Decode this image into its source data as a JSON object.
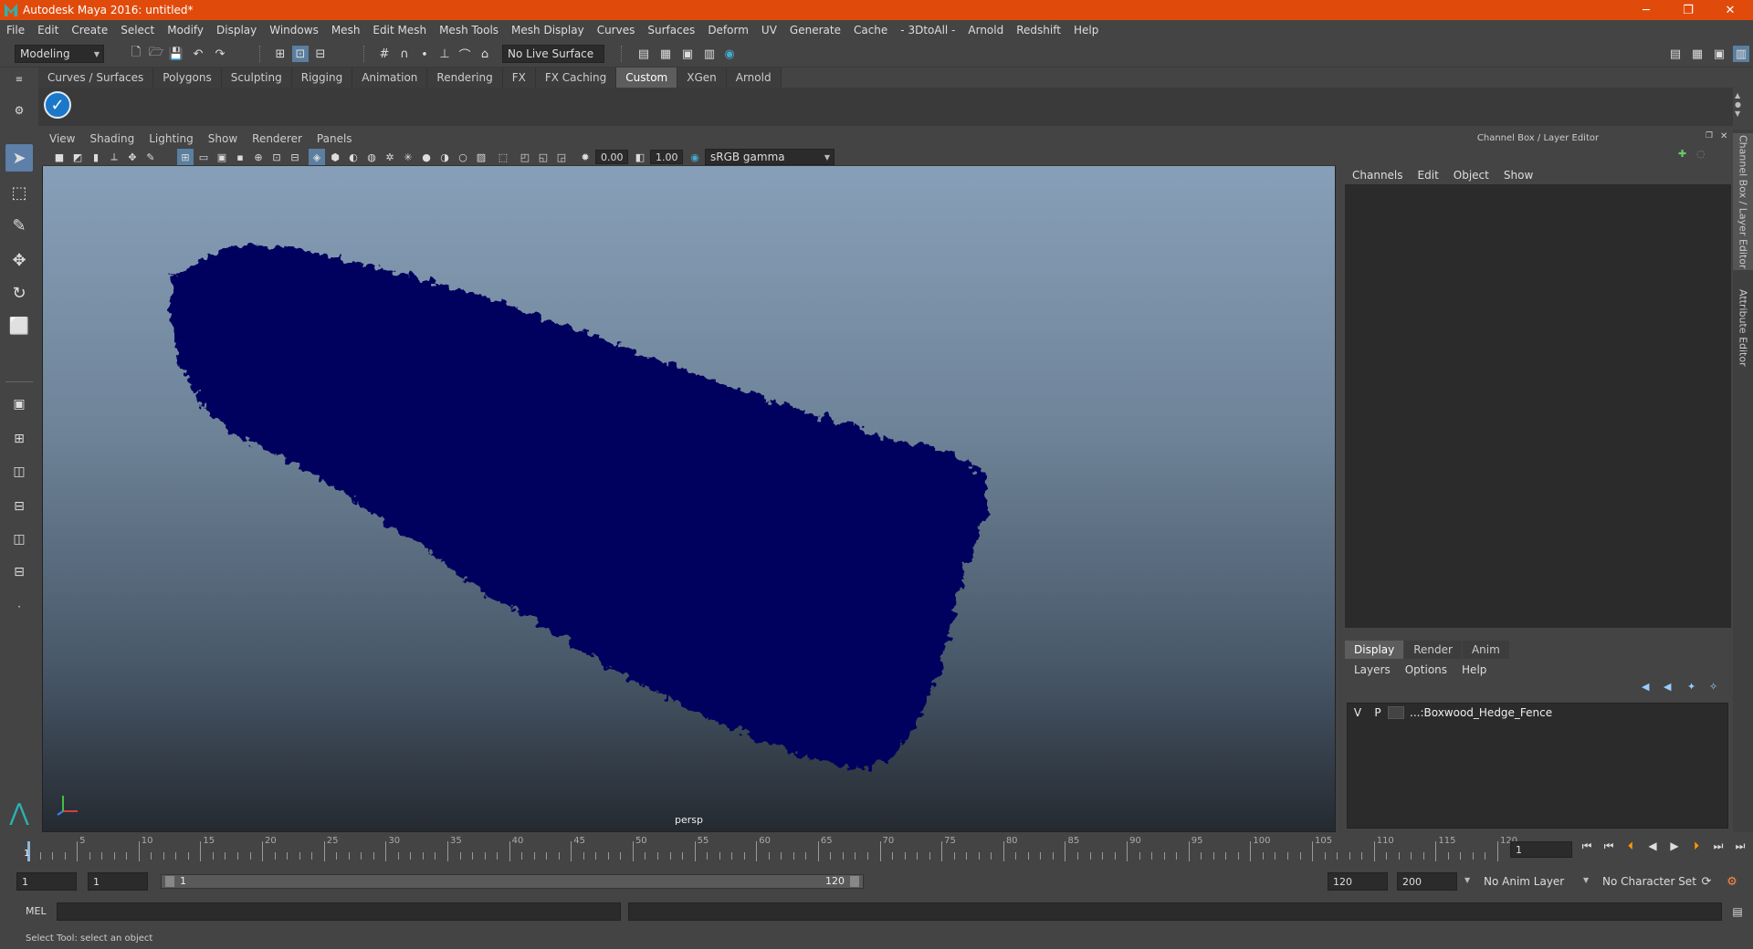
{
  "window": {
    "title": "Autodesk Maya 2016: untitled*",
    "minimize": "─",
    "restore": "❐",
    "close": "✕"
  },
  "menubar": [
    "File",
    "Edit",
    "Create",
    "Select",
    "Modify",
    "Display",
    "Windows",
    "Mesh",
    "Edit Mesh",
    "Mesh Tools",
    "Mesh Display",
    "Curves",
    "Surfaces",
    "Deform",
    "UV",
    "Generate",
    "Cache",
    "- 3DtoAll -",
    "Arnold",
    "Redshift",
    "Help"
  ],
  "statusline": {
    "menuset": "Modeling",
    "live_surface": "No Live Surface"
  },
  "shelf": {
    "tabs": [
      "Curves / Surfaces",
      "Polygons",
      "Sculpting",
      "Rigging",
      "Animation",
      "Rendering",
      "FX",
      "FX Caching",
      "Custom",
      "XGen",
      "Arnold"
    ],
    "active_tab": "Custom"
  },
  "viewport": {
    "menu": [
      "View",
      "Shading",
      "Lighting",
      "Show",
      "Renderer",
      "Panels"
    ],
    "exposure": "0.00",
    "gamma": "1.00",
    "color_space": "sRGB gamma",
    "camera": "persp",
    "object_color": "#04045e",
    "axis_x_color": "#d04040",
    "axis_y_color": "#40c040",
    "axis_z_color": "#4080ff"
  },
  "channel_box": {
    "title": "Channel Box / Layer Editor",
    "menu": [
      "Channels",
      "Edit",
      "Object",
      "Show"
    ]
  },
  "layer_editor": {
    "tabs": [
      "Display",
      "Render",
      "Anim"
    ],
    "active_tab": "Display",
    "menu": [
      "Layers",
      "Options",
      "Help"
    ],
    "layers": [
      {
        "v": "V",
        "p": "P",
        "name": "...:Boxwood_Hedge_Fence"
      }
    ]
  },
  "side_tabs": [
    "Channel Box / Layer Editor",
    "Attribute Editor"
  ],
  "timeline": {
    "start": 1,
    "end": 120,
    "current_frame": "1",
    "labels": [
      5,
      10,
      15,
      20,
      25,
      30,
      35,
      40,
      45,
      50,
      55,
      60,
      65,
      70,
      75,
      80,
      85,
      90,
      95,
      100,
      105,
      110,
      115,
      120
    ]
  },
  "range": {
    "start_field": "1",
    "playback_start": "1",
    "slider_start": "1",
    "slider_end": "120",
    "playback_end": "120",
    "end_field": "200",
    "anim_layer": "No Anim Layer",
    "character_set": "No Character Set"
  },
  "command": {
    "label": "MEL"
  },
  "help": {
    "text": "Select Tool: select an object"
  }
}
